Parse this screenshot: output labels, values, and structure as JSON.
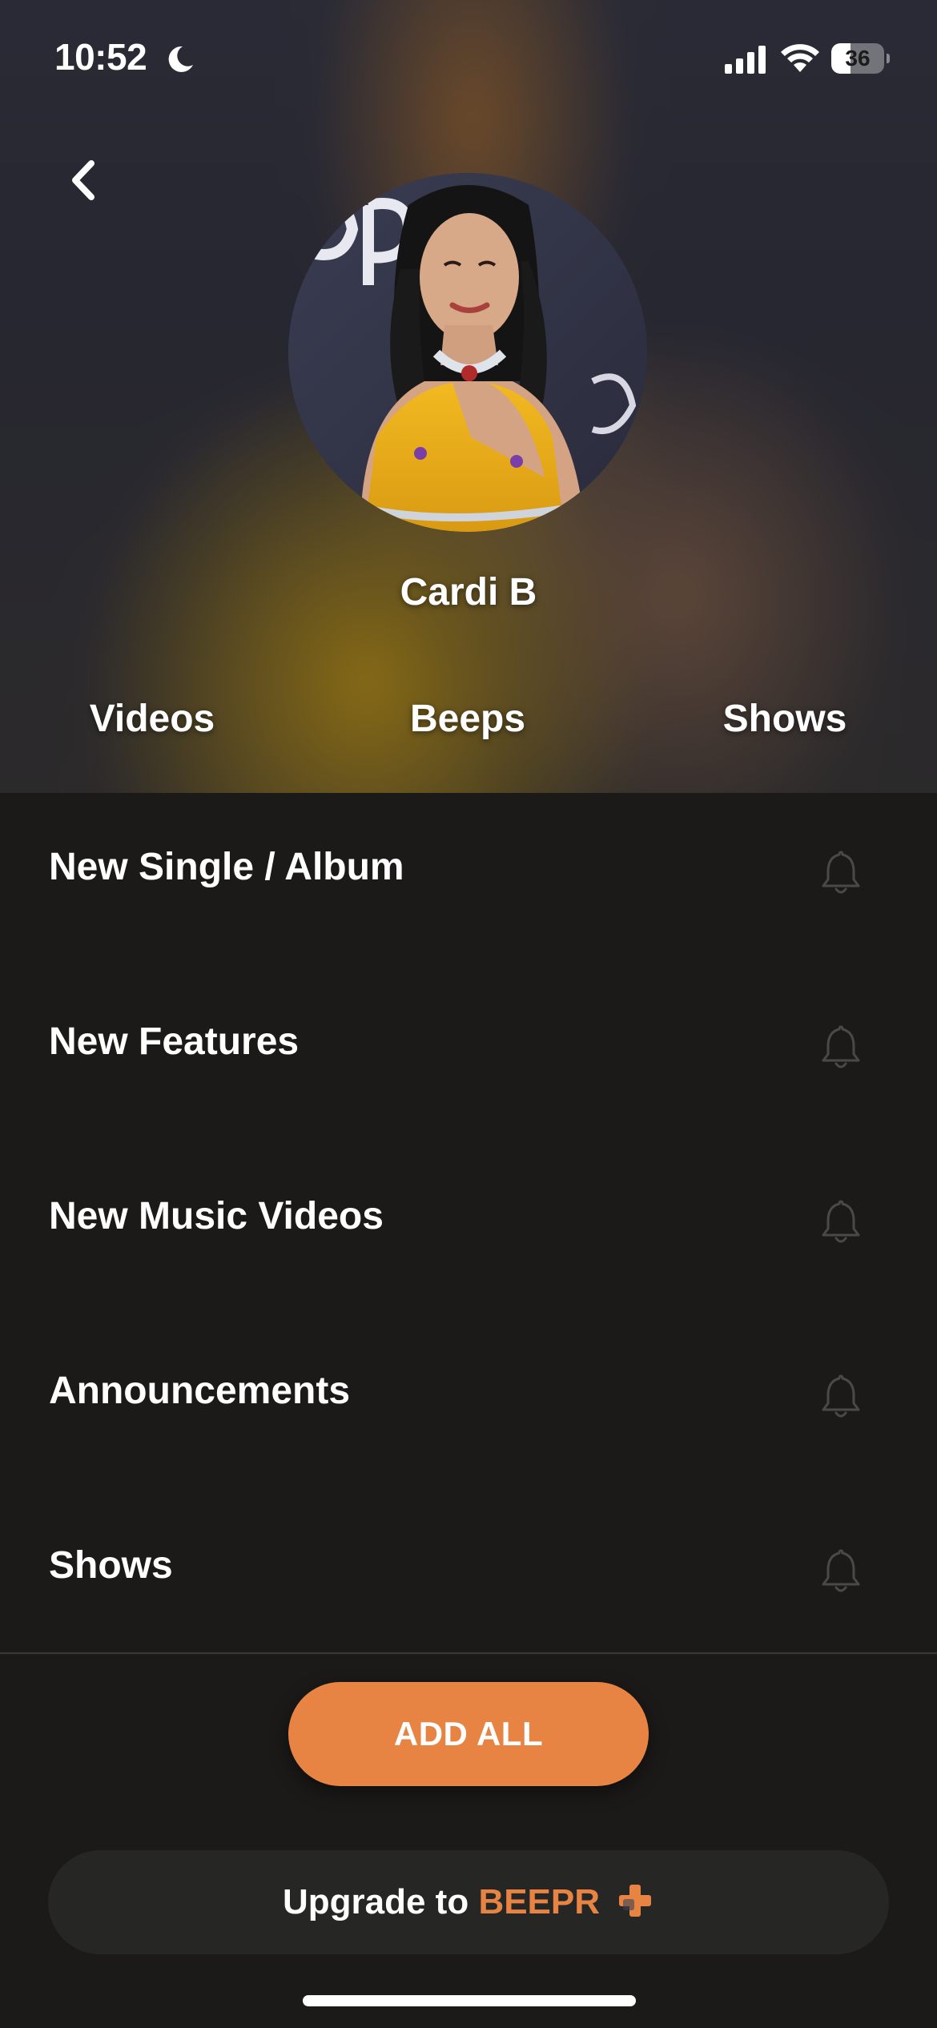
{
  "status_bar": {
    "time": "10:52",
    "battery_level": "36",
    "battery_fraction": 0.36,
    "icons": [
      "moon-icon",
      "signal-icon",
      "wifi-icon",
      "battery-icon"
    ]
  },
  "header": {
    "back_icon": "chevron-left-icon",
    "artist_name": "Cardi B"
  },
  "tabs": [
    {
      "label": "Videos"
    },
    {
      "label": "Beeps"
    },
    {
      "label": "Shows"
    }
  ],
  "notifications": [
    {
      "label": "New Single / Album",
      "icon": "bell-icon"
    },
    {
      "label": "New Features",
      "icon": "bell-icon"
    },
    {
      "label": "New Music Videos",
      "icon": "bell-icon"
    },
    {
      "label": "Announcements",
      "icon": "bell-icon"
    },
    {
      "label": "Shows",
      "icon": "bell-icon"
    }
  ],
  "actions": {
    "add_all_label": "ADD ALL",
    "upgrade_prefix": "Upgrade to",
    "upgrade_brand": "BEEPR",
    "upgrade_icon": "plus-icon"
  },
  "colors": {
    "accent": "#e78443",
    "background": "#1b1a19",
    "bell": "#4a4948"
  }
}
